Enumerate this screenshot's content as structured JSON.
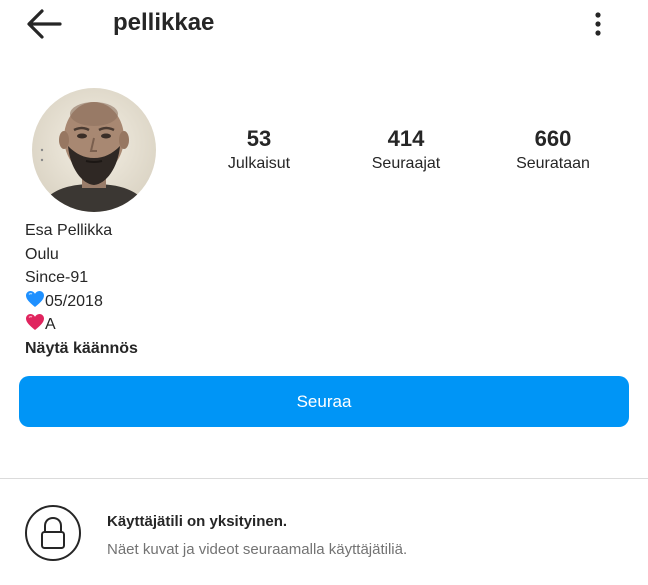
{
  "header": {
    "username": "pellikkae",
    "back_icon": "arrow-left-icon",
    "more_icon": "vertical-dots-icon"
  },
  "stats": {
    "posts": {
      "value": "53",
      "label": "Julkaisut"
    },
    "followers": {
      "value": "414",
      "label": "Seuraajat"
    },
    "following": {
      "value": "660",
      "label": "Seurataan"
    }
  },
  "bio": {
    "name": "Esa Pellikka",
    "line1": "Oulu",
    "line2": "Since-91",
    "line3_text": "05/2018",
    "line3_icon": "blue-heart-icon",
    "line4_text": "A",
    "line4_icon": "red-heart-icon",
    "translate_label": "Näytä käännös"
  },
  "follow_button": {
    "label": "Seuraa"
  },
  "private_notice": {
    "icon": "lock-icon",
    "title": "Käyttäjätili on yksityinen.",
    "subtitle": "Näet kuvat ja videot seuraamalla käyttäjätiliä."
  },
  "colors": {
    "accent": "#0095f6",
    "text_primary": "#262626",
    "text_secondary": "#737373",
    "divider": "#dbdbdb",
    "heart_blue": "#1e90ff",
    "heart_red": "#e0245e"
  }
}
